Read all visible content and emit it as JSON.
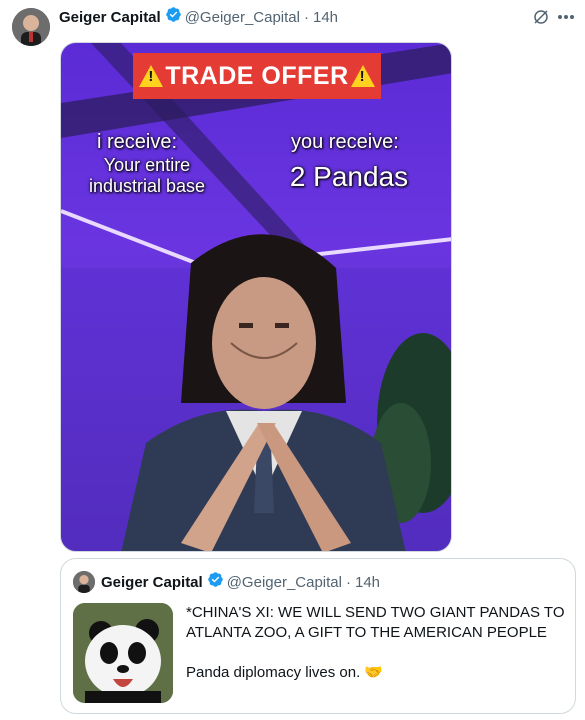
{
  "tweet": {
    "author_name": "Geiger Capital",
    "handle": "@Geiger_Capital",
    "separator": "·",
    "time": "14h"
  },
  "meme": {
    "banner": "TRADE OFFER",
    "left_label": "i receive:",
    "left_value": "Your entire industrial base",
    "right_label": "you receive:",
    "right_value": "2 Pandas"
  },
  "quoted": {
    "author_name": "Geiger Capital",
    "handle": "@Geiger_Capital",
    "separator": "·",
    "time": "14h",
    "headline": "*CHINA'S XI: WE WILL SEND TWO GIANT PANDAS TO ATLANTA ZOO, A GIFT TO THE AMERICAN PEOPLE",
    "comment": "Panda diplomacy lives on. 🤝"
  },
  "icons": {
    "verified": "verified-badge-icon",
    "grok": "grok-icon",
    "more": "more-icon"
  },
  "colors": {
    "verified": "#1d9bf0",
    "banner": "#e53b35",
    "muted": "#536471"
  }
}
